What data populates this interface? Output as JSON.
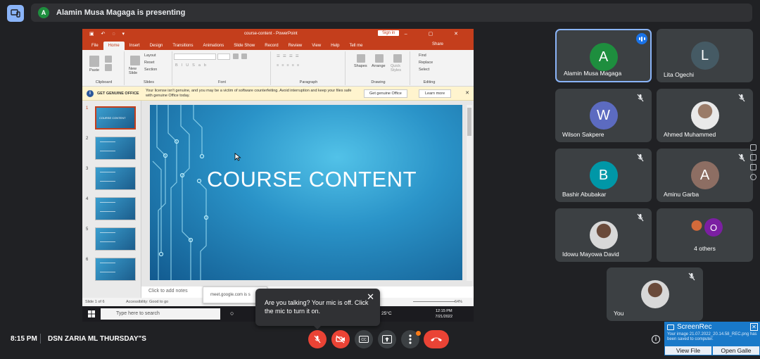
{
  "presenting": {
    "avatar_letter": "A",
    "text": "Alamin Musa Magaga is presenting"
  },
  "ppt": {
    "doc_title": "course-content - PowerPoint",
    "sign_in": "Sign in",
    "tabs": [
      "File",
      "Home",
      "Insert",
      "Design",
      "Transitions",
      "Animations",
      "Slide Show",
      "Record",
      "Review",
      "View",
      "Help",
      "Tell me"
    ],
    "share": "Share",
    "ribbon": {
      "paste": "Paste",
      "clipboard": "Clipboard",
      "new_slide": "New Slide",
      "layout": "Layout",
      "reset": "Reset",
      "section": "Section",
      "slides": "Slides",
      "font": "Font",
      "paragraph": "Paragraph",
      "shapes": "Shapes",
      "arrange": "Arrange",
      "quick_styles": "Quick Styles",
      "drawing": "Drawing",
      "find": "Find",
      "replace": "Replace",
      "select": "Select",
      "editing": "Editing"
    },
    "genuine": {
      "label": "GET GENUINE OFFICE",
      "message": "Your license isn't genuine, and you may be a victim of software counterfeiting. Avoid interruption and keep your files safe with genuine Office today.",
      "btn_get": "Get genuine Office",
      "btn_learn": "Learn more"
    },
    "slide_numbers": [
      "1",
      "2",
      "3",
      "4",
      "5",
      "6"
    ],
    "thumb_title": "COURSE CONTENT",
    "slide_title": "COURSE CONTENT",
    "notes_placeholder": "Click to add notes",
    "status": {
      "slide_count": "Slide 1 of 6",
      "accessibility": "Accessibility: Good to go",
      "zoom": "64%"
    },
    "taskbar": {
      "search_placeholder": "Type here to search",
      "temp": "25°C",
      "time": "12:15 PM",
      "date": "7/21/2022"
    },
    "url_popup": "meet.google.com is s"
  },
  "participants": [
    {
      "name": "Alamin Musa Magaga",
      "letter": "A",
      "color": "#1e8e3e",
      "speaking": true
    },
    {
      "name": "Lita Ogechi",
      "letter": "L",
      "color": "#455a64"
    },
    {
      "name": "Wilson Sakpere",
      "letter": "W",
      "color": "#5c6bc0"
    },
    {
      "name": "Ahmed Muhammed",
      "letter": "",
      "photo": true
    },
    {
      "name": "Bashir Abubakar",
      "letter": "B",
      "color": "#0097a7"
    },
    {
      "name": "Aminu Garba",
      "letter": "A",
      "color": "#8d6e63"
    },
    {
      "name": "Idowu Mayowa David",
      "letter": "",
      "photo": true
    },
    {
      "name": "4 others",
      "letter": "O",
      "color": "#7b1fa2"
    },
    {
      "name": "You",
      "letter": "",
      "photo": true
    }
  ],
  "toast": {
    "message": "Are you talking? Your mic is off. Click the mic to turn it on."
  },
  "meeting": {
    "time": "8:15 PM",
    "name": "DSN ZARIA ML THURSDAY\"S"
  },
  "screenrec": {
    "title": "ScreenRec",
    "message": "Your image 21.07.2022_20.14.58_REC.png has been saved to computer.",
    "view_file": "View File",
    "open_gallery": "Open Galle"
  },
  "colors": {
    "accent": "#8ab4f8",
    "end_call": "#ea4335",
    "tile": "#3c4043",
    "ppt_brand": "#c43e1c"
  }
}
